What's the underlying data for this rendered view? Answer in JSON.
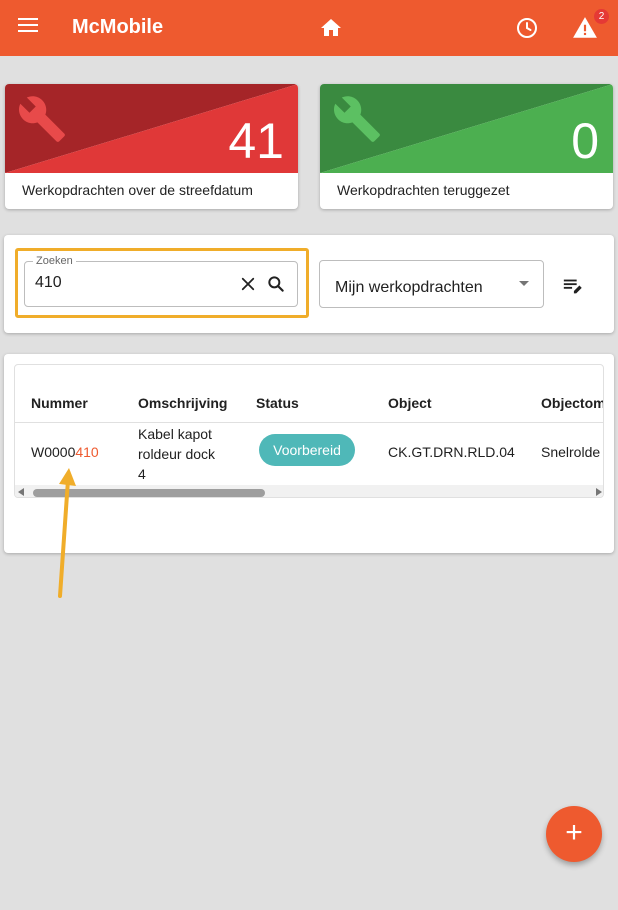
{
  "app": {
    "title": "McMobile",
    "notification_count": "2"
  },
  "icons": {
    "menu": "menu-icon",
    "home": "home-icon",
    "history": "clock-icon",
    "alerts": "warning-icon",
    "wrench": "wrench-icon",
    "clear": "close-icon",
    "search": "search-icon",
    "edit_list": "edit-list-icon",
    "add": "plus-icon"
  },
  "stats": [
    {
      "value": "41",
      "label": "Werkopdrachten over de streefdatum",
      "color_dark": "#a52528",
      "color_light": "#e03838"
    },
    {
      "value": "0",
      "label": "Werkopdrachten teruggezet",
      "color_dark": "#3a8a40",
      "color_light": "#4caf50"
    }
  ],
  "search": {
    "legend": "Zoeken",
    "value": "410"
  },
  "filter": {
    "selected": "Mijn werkopdrachten"
  },
  "table": {
    "columns": [
      "Nummer",
      "Omschrijving",
      "Status",
      "Object",
      "Objectom"
    ],
    "rows": [
      {
        "nummer_prefix": "W0000",
        "nummer_match": "410",
        "omschrijving": [
          "Kabel kapot",
          "roldeur dock",
          "4"
        ],
        "status": "Voorbereid",
        "object": "CK.GT.DRN.RLD.04",
        "objectomschrijving": "Snelrolde"
      }
    ]
  },
  "colors": {
    "brand": "#ee5a2f",
    "status_chip": "#4fb8b8",
    "highlight": "#f0ad2a"
  },
  "fab": {
    "label": "+"
  }
}
